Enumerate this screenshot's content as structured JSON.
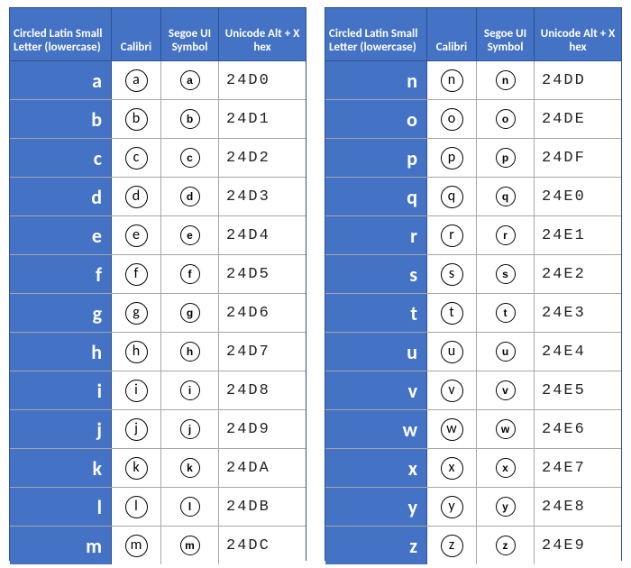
{
  "headers": {
    "letter": "Circled Latin Small Letter (lowercase)",
    "calibri": "Calibri",
    "symbol": "Segoe UI Symbol",
    "hex": "Unicode Alt + X hex"
  },
  "left": [
    {
      "letter": "a",
      "hex": "24D0"
    },
    {
      "letter": "b",
      "hex": "24D1"
    },
    {
      "letter": "c",
      "hex": "24D2"
    },
    {
      "letter": "d",
      "hex": "24D3"
    },
    {
      "letter": "e",
      "hex": "24D4"
    },
    {
      "letter": "f",
      "hex": "24D5"
    },
    {
      "letter": "g",
      "hex": "24D6"
    },
    {
      "letter": "h",
      "hex": "24D7"
    },
    {
      "letter": "i",
      "hex": "24D8"
    },
    {
      "letter": "j",
      "hex": "24D9"
    },
    {
      "letter": "k",
      "hex": "24DA"
    },
    {
      "letter": "l",
      "hex": "24DB"
    },
    {
      "letter": "m",
      "hex": "24DC"
    }
  ],
  "right": [
    {
      "letter": "n",
      "hex": "24DD"
    },
    {
      "letter": "o",
      "hex": "24DE"
    },
    {
      "letter": "p",
      "hex": "24DF"
    },
    {
      "letter": "q",
      "hex": "24E0"
    },
    {
      "letter": "r",
      "hex": "24E1"
    },
    {
      "letter": "s",
      "hex": "24E2"
    },
    {
      "letter": "t",
      "hex": "24E3"
    },
    {
      "letter": "u",
      "hex": "24E4"
    },
    {
      "letter": "v",
      "hex": "24E5"
    },
    {
      "letter": "w",
      "hex": "24E6"
    },
    {
      "letter": "x",
      "hex": "24E7"
    },
    {
      "letter": "y",
      "hex": "24E8"
    },
    {
      "letter": "z",
      "hex": "24E9"
    }
  ]
}
